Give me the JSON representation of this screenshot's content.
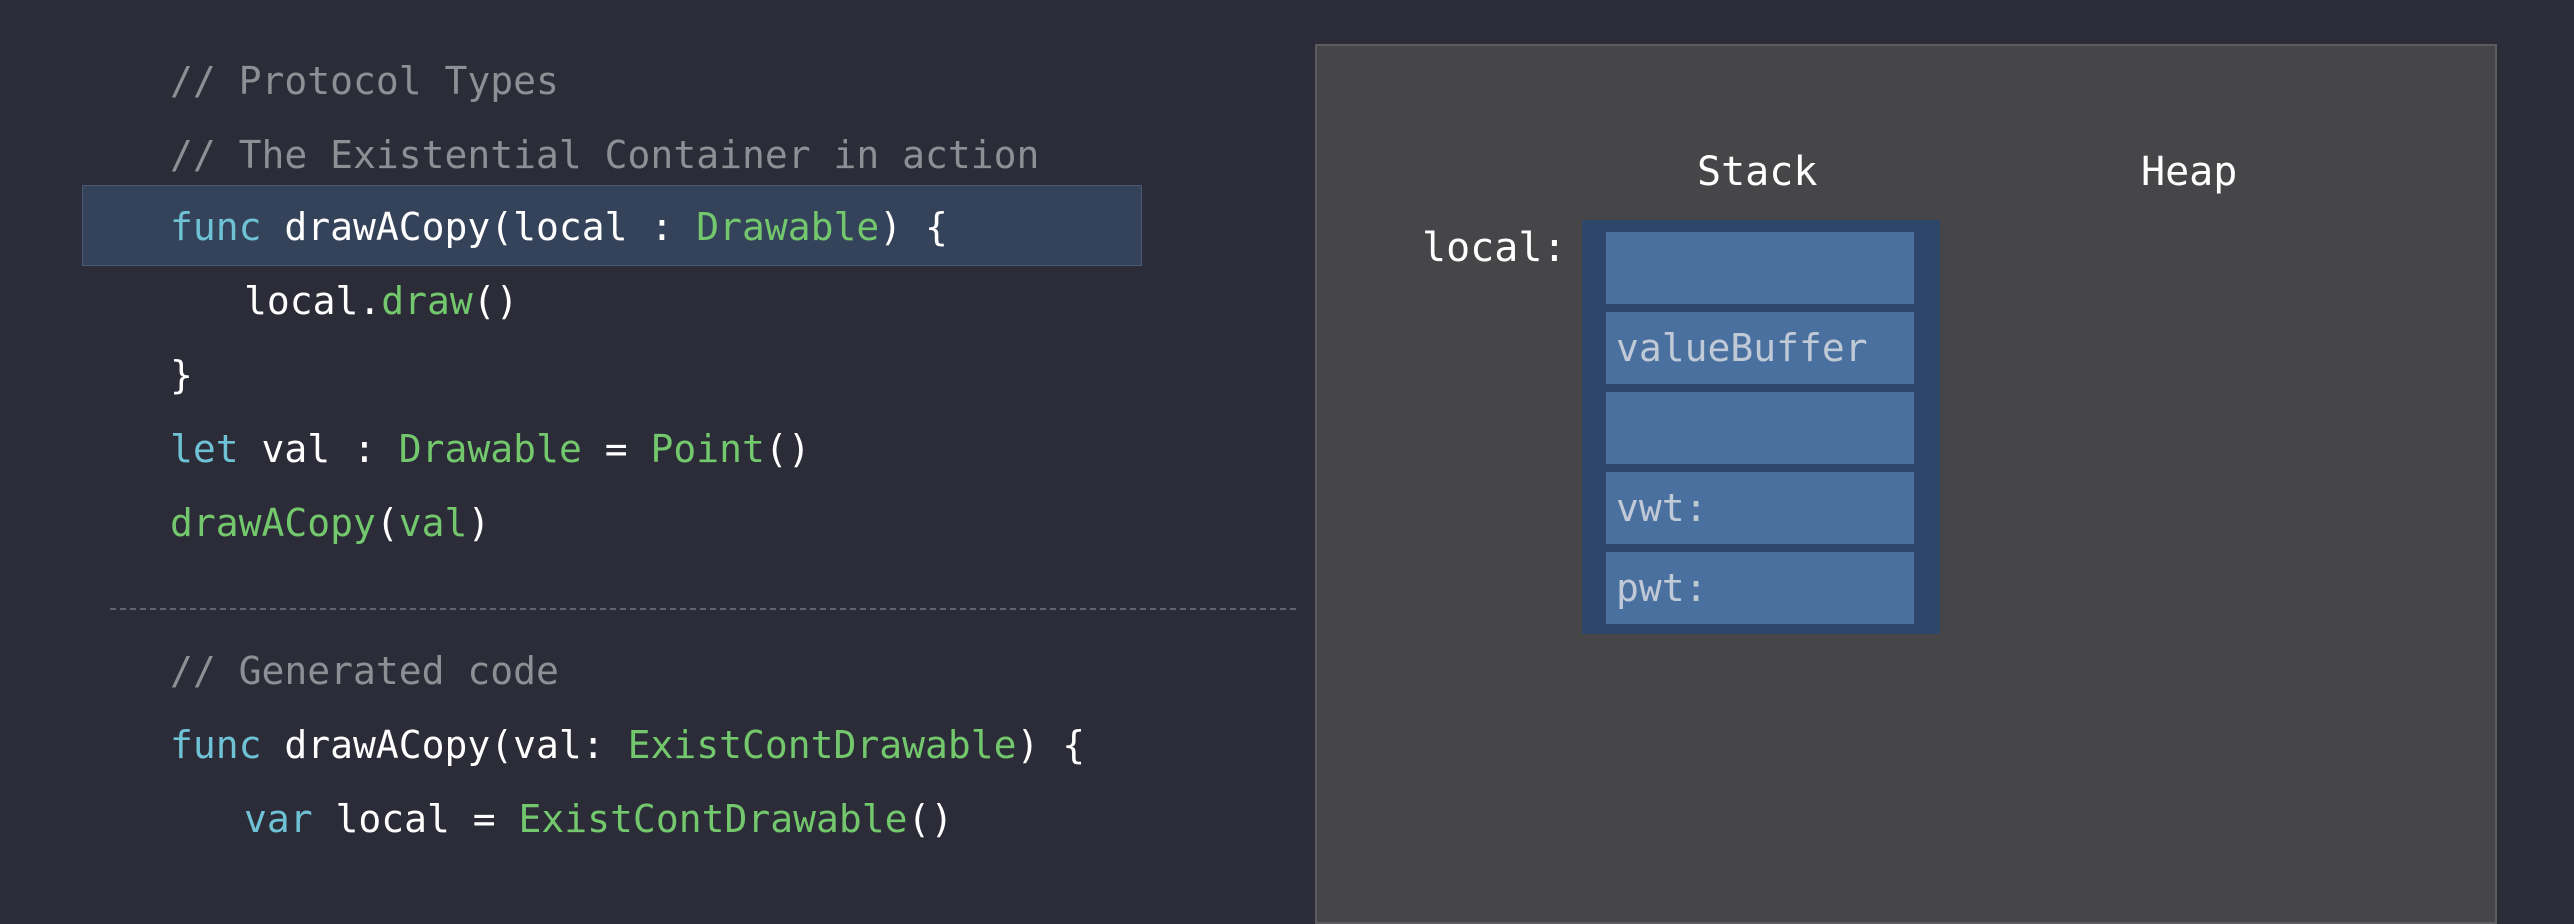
{
  "code": {
    "top": [
      {
        "tokens": [
          {
            "t": "// Protocol Types",
            "c": "comment"
          }
        ]
      },
      {
        "tokens": [
          {
            "t": "// The Existential Container in action",
            "c": "comment"
          }
        ]
      },
      {
        "tokens": [
          {
            "t": "func",
            "c": "kw"
          },
          {
            "t": " drawACopy(local : ",
            "c": "plain"
          },
          {
            "t": "Drawable",
            "c": "type"
          },
          {
            "t": ") {",
            "c": "plain"
          }
        ]
      },
      {
        "tokens": [
          {
            "t": "local.",
            "c": "plain"
          },
          {
            "t": "draw",
            "c": "type"
          },
          {
            "t": "()",
            "c": "plain"
          }
        ]
      },
      {
        "tokens": [
          {
            "t": "}",
            "c": "plain"
          }
        ]
      },
      {
        "tokens": [
          {
            "t": "let",
            "c": "kw"
          },
          {
            "t": " val : ",
            "c": "plain"
          },
          {
            "t": "Drawable",
            "c": "type"
          },
          {
            "t": " = ",
            "c": "plain"
          },
          {
            "t": "Point",
            "c": "type"
          },
          {
            "t": "()",
            "c": "plain"
          }
        ]
      },
      {
        "tokens": [
          {
            "t": "drawACopy",
            "c": "type"
          },
          {
            "t": "(",
            "c": "plain"
          },
          {
            "t": "val",
            "c": "type"
          },
          {
            "t": ")",
            "c": "plain"
          }
        ]
      }
    ],
    "bottom": [
      {
        "tokens": [
          {
            "t": "// Generated code",
            "c": "comment"
          }
        ]
      },
      {
        "tokens": [
          {
            "t": "func",
            "c": "kw"
          },
          {
            "t": " drawACopy(val: ",
            "c": "plain"
          },
          {
            "t": "ExistContDrawable",
            "c": "type"
          },
          {
            "t": ") {",
            "c": "plain"
          }
        ]
      },
      {
        "tokens": [
          {
            "t": "var",
            "c": "kw"
          },
          {
            "t": " local = ",
            "c": "plain"
          },
          {
            "t": "ExistContDrawable",
            "c": "type"
          },
          {
            "t": "()",
            "c": "plain"
          }
        ]
      }
    ]
  },
  "diagram": {
    "stack_label": "Stack",
    "heap_label": "Heap",
    "local_label": "local:",
    "cells": [
      "",
      "valueBuffer",
      "",
      "vwt:",
      "pwt:"
    ]
  },
  "colors": {
    "background": "#2b2c37",
    "comment": "#8e8f95",
    "keyword": "#6fc2d5",
    "type": "#73c86d",
    "panel": "#464648",
    "container_frame": "#2e4669",
    "cell": "#4a70a0"
  }
}
